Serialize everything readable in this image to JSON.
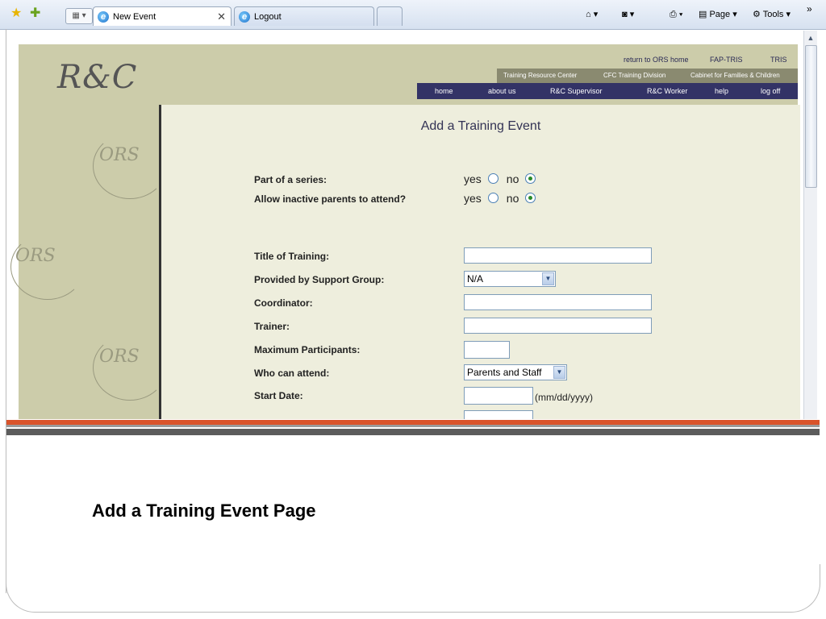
{
  "browser": {
    "tabs": [
      {
        "label": "New Event"
      },
      {
        "label": "Logout"
      }
    ],
    "tools": {
      "page_label": "Page",
      "tools_label": "Tools"
    }
  },
  "site": {
    "logo": "R&C",
    "top_links": [
      "return to ORS home",
      "FAP-TRIS",
      "TRIS"
    ],
    "sub_links": [
      "Training Resource Center",
      "CFC Training Division",
      "Cabinet for Families & Children"
    ],
    "nav": [
      "home",
      "about us",
      "R&C Supervisor",
      "R&C Worker",
      "help",
      "log off"
    ],
    "watermark": "ORS"
  },
  "form": {
    "title": "Add a Training Event",
    "radios": [
      {
        "label": "Part of a series:",
        "yes": "yes",
        "no": "no",
        "selected": "no"
      },
      {
        "label": "Allow inactive parents to attend?",
        "yes": "yes",
        "no": "no",
        "selected": "no"
      }
    ],
    "fields": {
      "title_label": "Title of Training:",
      "support_group_label": "Provided by Support Group:",
      "support_group_value": "N/A",
      "coordinator_label": "Coordinator:",
      "trainer_label": "Trainer:",
      "max_participants_label": "Maximum Participants:",
      "who_can_attend_label": "Who can attend:",
      "who_can_attend_value": "Parents and Staff",
      "start_date_label": "Start Date:",
      "date_hint": "(mm/dd/yyyy)"
    }
  },
  "slide": {
    "caption": "Add a Training Event Page"
  },
  "colors": {
    "site_bg": "#ccccaa",
    "content_bg": "#eeeedd",
    "nav_bg": "#333366",
    "accent_stripe": "#d9532a"
  }
}
